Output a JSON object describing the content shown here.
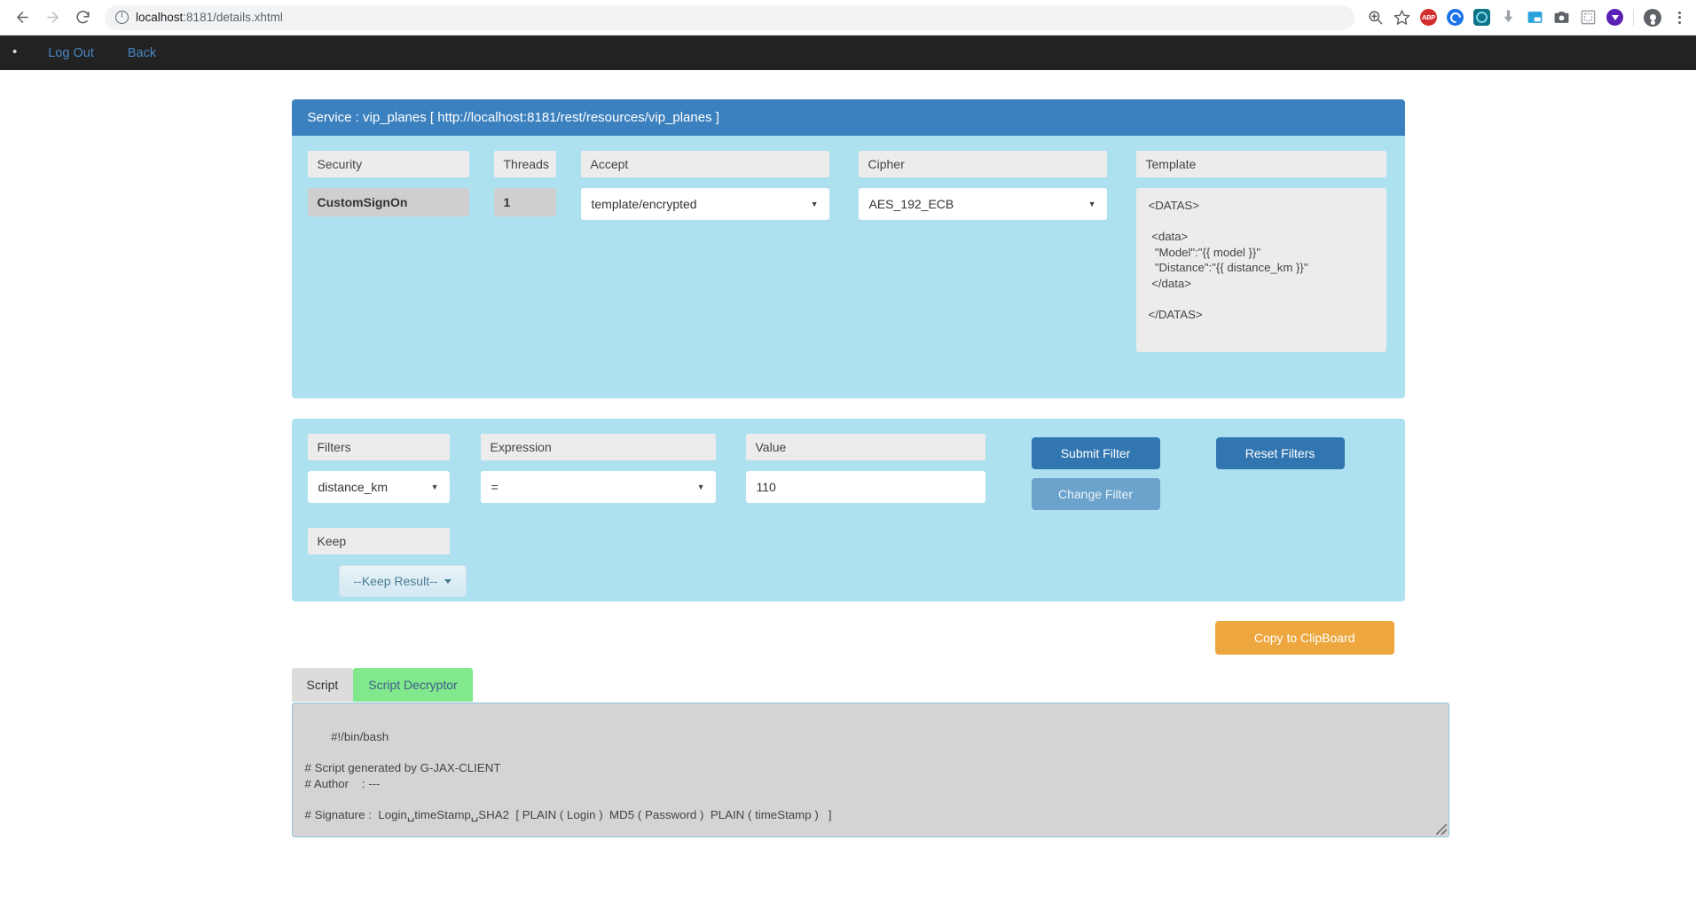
{
  "browser": {
    "url_host": "localhost",
    "url_rest": ":8181/details.xhtml",
    "back_icon": "back-arrow-icon",
    "forward_icon": "forward-arrow-icon",
    "reload_icon": "reload-icon",
    "zoom_icon": "zoom-in-icon",
    "bookmark_icon": "star-icon",
    "extensions": [
      "ABP",
      "blue-circle-icon",
      "teal-circle-icon",
      "download-arrow-icon",
      "picture-in-picture-icon",
      "camera-icon",
      "screenshot-frame-icon",
      "purple-download-icon"
    ],
    "menu_icon": "kebab-menu-icon",
    "profile_icon": "profile-avatar-icon"
  },
  "navbar": {
    "bullet": "•",
    "logout_label": "Log Out",
    "back_label": "Back"
  },
  "service": {
    "header": "Service : vip_planes [ http://localhost:8181/rest/resources/vip_planes ]",
    "security_label": "Security",
    "security_value": "CustomSignOn",
    "threads_label": "Threads",
    "threads_value": "1",
    "accept_label": "Accept",
    "accept_value": "template/encrypted",
    "cipher_label": "Cipher",
    "cipher_value": "AES_192_ECB",
    "template_label": "Template",
    "template_value": "<DATAS>\n\n <data>\n  \"Model\":\"{{ model }}\"\n  \"Distance\":\"{{ distance_km }}\"\n </data>\n\n</DATAS>"
  },
  "filters": {
    "filters_label": "Filters",
    "filters_value": "distance_km",
    "expression_label": "Expression",
    "expression_value": "=",
    "value_label": "Value",
    "value_value": "110",
    "keep_label": "Keep",
    "keep_value": "--Keep Result--",
    "submit_label": "Submit Filter",
    "change_label": "Change Filter",
    "reset_label": "Reset Filters"
  },
  "clipboard": {
    "label": "Copy to ClipBoard"
  },
  "tabs": {
    "script_label": "Script",
    "decryptor_label": "Script Decryptor"
  },
  "script": {
    "content": "#!/bin/bash\n\n# Script generated by G-JAX-CLIENT\n# Author    : ---\n\n# Signature :  Login␣timeStamp␣SHA2  [ PLAIN ( Login )  MD5 ( Password )  PLAIN ( timeStamp )   ]"
  },
  "colors": {
    "accent_blue": "#3b81bf",
    "panel_blue": "#ade1f0",
    "button_blue": "#3276b1",
    "orange": "#eda73e",
    "green_tab": "#81e98b",
    "navbar_dark": "#222222"
  }
}
